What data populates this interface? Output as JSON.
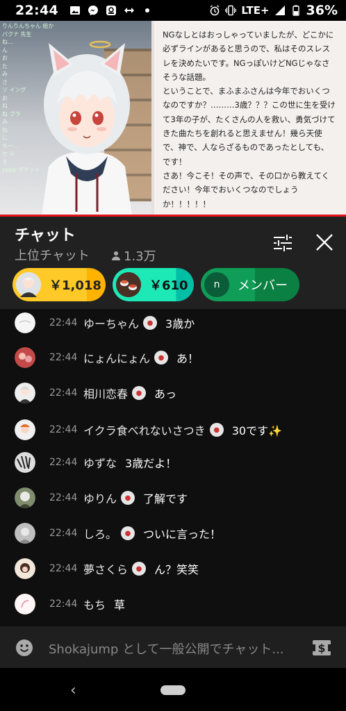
{
  "status_bar": {
    "time": "22:44",
    "network": "LTE+",
    "battery": "36%",
    "icons": [
      "image-icon",
      "messenger-icon",
      "app-icon",
      "arrows-icon",
      "dot-icon",
      "alarm-icon",
      "vibrate-icon",
      "signal-icon",
      "battery-icon"
    ]
  },
  "video": {
    "caption": "NGなしとはおっしゃっていましたが、どこかに\n必ずラインがあると思うので、私はそのスレス\nレを決めたいです。NGっぽいけどNGじゃなさ\nそうな話題。\nということで、まふまふさんは今年でおいくつ\nなのですか？………3歳？？？この世に生を受け\nて3年の子が、たくさんの人を救い、勇気づけて\nきた曲たちを創れると思えません！幾ら天使\nで、神で、人ならざるものであったとしても、\nです！\nさあ！今こそ！その声で、その口から教えてく\nださい！今年でおいくつなのでしょう\nか！！！！！",
    "chatlog": [
      "りんりんちゃん 絵かいた",
      "パクナ 先生",
      "ね…",
      "ん",
      "お",
      "た",
      "み",
      "さ",
      "ソ イング",
      "お",
      "ね",
      "ね ブラ",
      "み",
      "ね",
      "に",
      "ちー…",
      "セ ル",
      "モ",
      "pppp ポケット"
    ]
  },
  "chat_header": {
    "title": "チャット",
    "mode": "上位チャット",
    "viewers": "1.3万"
  },
  "pills": [
    {
      "amount": "￥1,018"
    },
    {
      "amount": "￥610"
    },
    {
      "initial": "n",
      "label": "メンバー"
    }
  ],
  "messages": [
    {
      "time": "22:44",
      "author": "ゆーちゃん",
      "text": "3歳か"
    },
    {
      "time": "22:44",
      "author": "にょんにょん",
      "text": "あ！"
    },
    {
      "time": "22:44",
      "author": "相川恋春",
      "text": "あっ"
    },
    {
      "time": "22:44",
      "author": "イクラ食べれないさつき",
      "text": "30です✨"
    },
    {
      "time": "22:44",
      "author": "ゆずな",
      "text": "3歳だよ！"
    },
    {
      "time": "22:44",
      "author": "ゆりん",
      "text": "了解です"
    },
    {
      "time": "22:44",
      "author": "しろ。",
      "text": "ついに言った！"
    },
    {
      "time": "22:44",
      "author": "夢さくら",
      "text": "ん？笑笑"
    },
    {
      "time": "22:44",
      "author": "もち",
      "text": "草"
    }
  ],
  "input": {
    "placeholder": "Shokajump として一般公開でチャット..."
  }
}
